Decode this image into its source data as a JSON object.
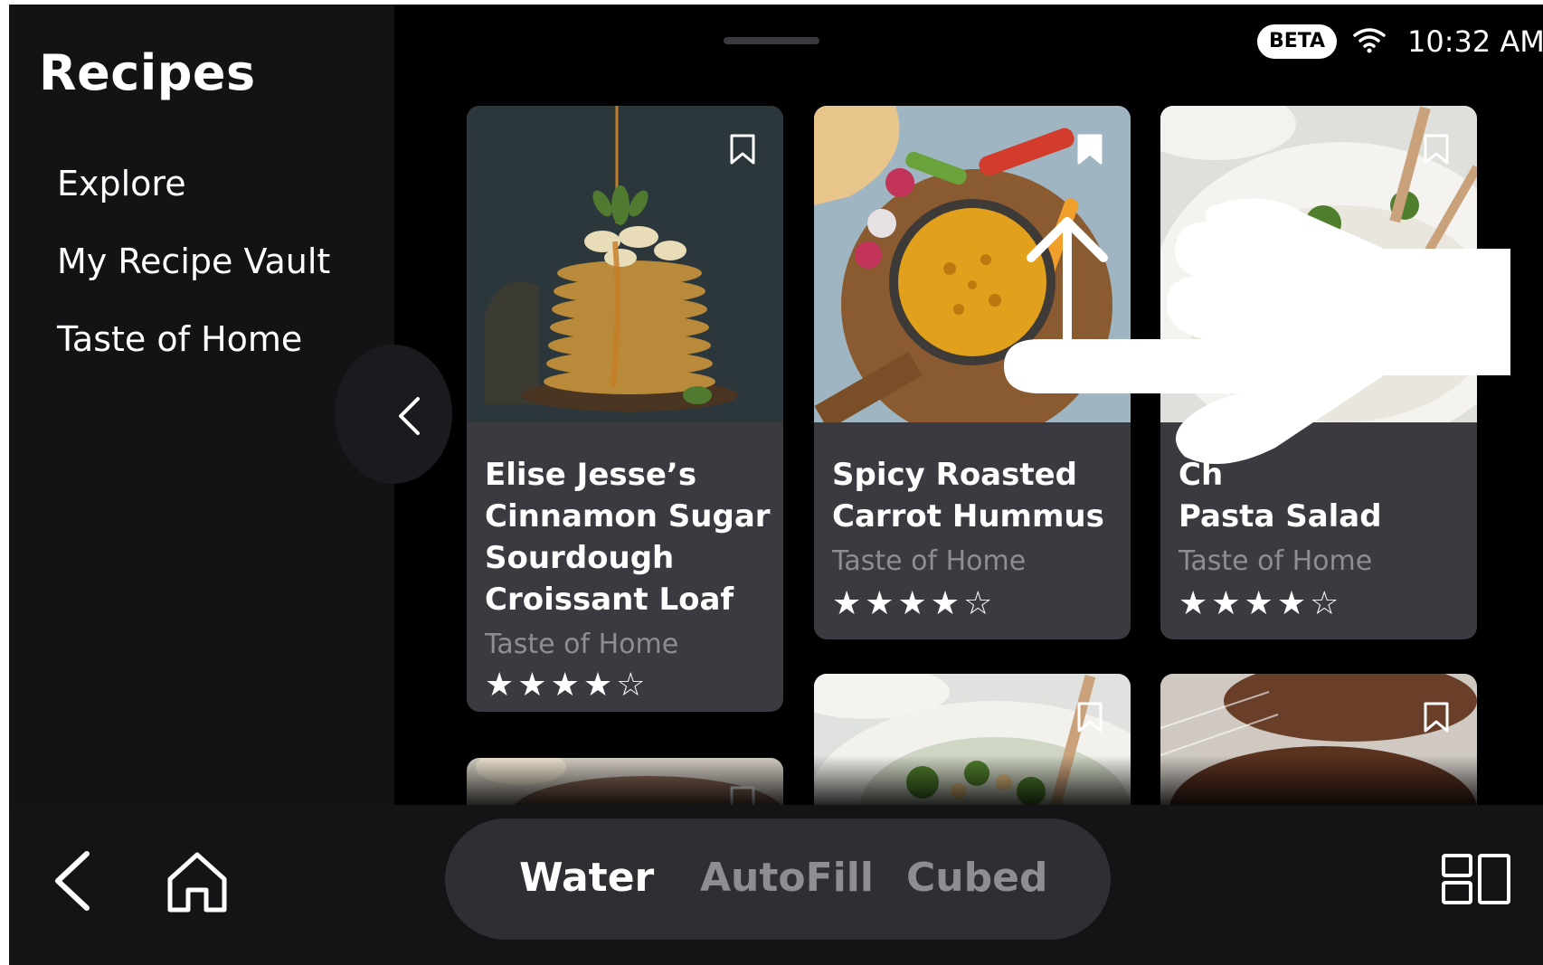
{
  "sidebar": {
    "title": "Recipes",
    "items": [
      {
        "label": "Explore"
      },
      {
        "label": "My Recipe Vault"
      },
      {
        "label": "Taste of Home"
      }
    ]
  },
  "status": {
    "beta_label": "BETA",
    "time": "10:32 AM",
    "wifi_icon": "wifi-icon"
  },
  "cards": [
    {
      "title_lines": [
        "Elise Jesse’s",
        "Cinnamon Sugar",
        "Sourdough",
        "Croissant Loaf"
      ],
      "source": "Taste of Home",
      "rating": 4,
      "stars": "★★★★☆",
      "bookmarked": false,
      "photo": "pancake-stack"
    },
    {
      "title_lines": [
        "Spicy Roasted",
        "Carrot Hummus"
      ],
      "source": "Taste of Home",
      "rating": 4,
      "stars": "★★★★☆",
      "bookmarked": true,
      "photo": "carrot-hummus"
    },
    {
      "title_lines": [
        "Ch",
        "Pasta Salad"
      ],
      "source": "Taste of Home",
      "rating": 4,
      "stars": "★★★★☆",
      "bookmarked": false,
      "photo": "pasta-salad"
    }
  ],
  "bottom": {
    "modes": [
      {
        "label": "Water",
        "active": true
      },
      {
        "label": "AutoFill",
        "active": false
      },
      {
        "label": "Cubed",
        "active": false
      }
    ]
  },
  "colors": {
    "background": "#000000",
    "sidebar": "#131316",
    "card": "#3a3a40",
    "muted_text": "#8d8d92",
    "active_mode": "#ffffff",
    "inactive_mode": "#8d8d92"
  }
}
